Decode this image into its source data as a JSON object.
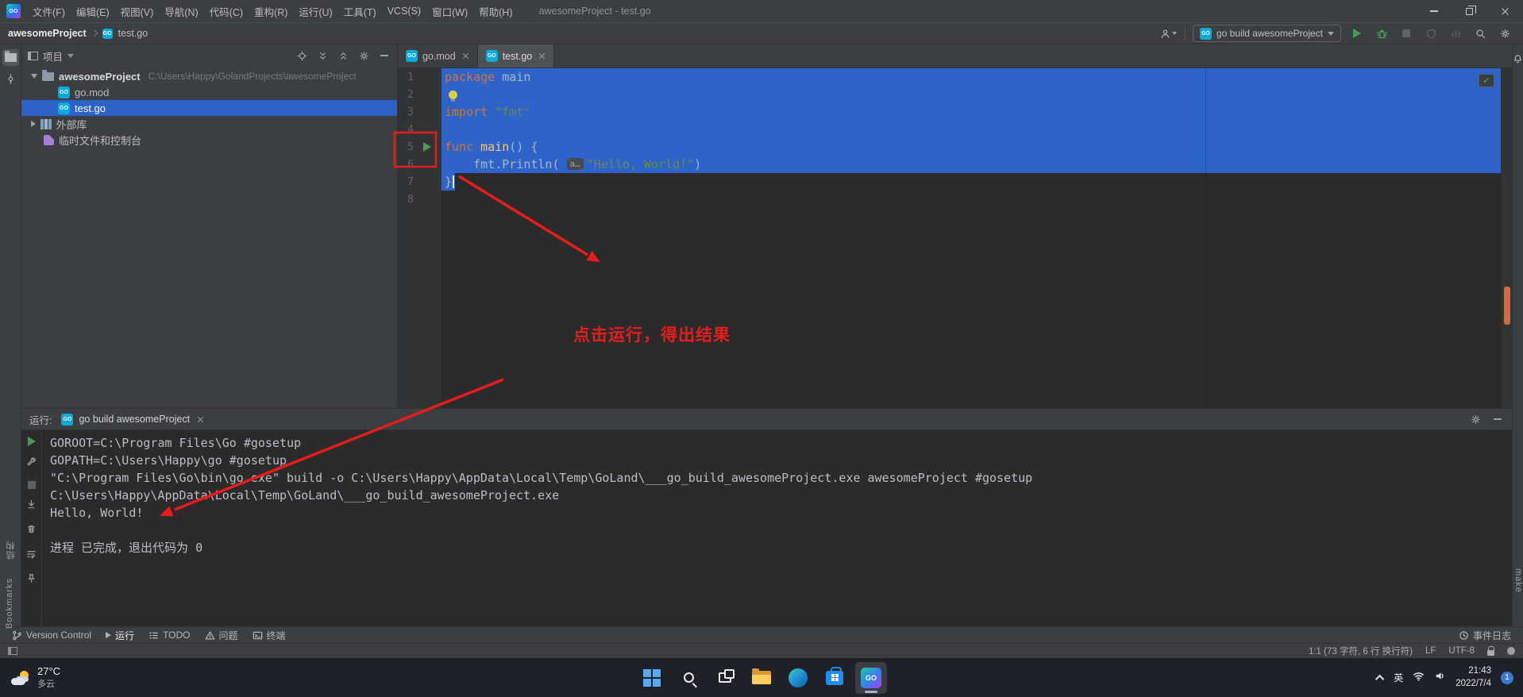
{
  "title_bar": {
    "app": "GO",
    "menus": [
      "文件(F)",
      "编辑(E)",
      "视图(V)",
      "导航(N)",
      "代码(C)",
      "重构(R)",
      "运行(U)",
      "工具(T)",
      "VCS(S)",
      "窗口(W)",
      "帮助(H)"
    ],
    "title": "awesomeProject - test.go"
  },
  "toolbar": {
    "breadcrumb_project": "awesomeProject",
    "breadcrumb_file": "test.go",
    "run_config": "go build awesomeProject"
  },
  "left_stripe": {
    "structure_label": "结构",
    "bookmarks_label": "Bookmarks"
  },
  "right_stripe": {
    "make_label": "make"
  },
  "project_panel": {
    "title": "项目",
    "root_name": "awesomeProject",
    "root_path": "C:\\Users\\Happy\\GolandProjects\\awesomeProject",
    "file1": "go.mod",
    "file2": "test.go",
    "external_libs": "外部库",
    "scratches": "临时文件和控制台"
  },
  "editor": {
    "tab1": "go.mod",
    "tab2": "test.go",
    "line_numbers": [
      "1",
      "2",
      "3",
      "4",
      "5",
      "6",
      "7",
      "8"
    ],
    "code": {
      "l1_kw": "package",
      "l1_id": " main",
      "l3_kw": "import",
      "l3_str": " \"fmt\"",
      "l5_kw": "func",
      "l5_fn": " main",
      "l5_tail": "() {",
      "l6_lead": "    fmt.",
      "l6_fn": "Println",
      "l6_paren": "( ",
      "l6_hint": "a…",
      "l6_str": "\"Hello, World!\"",
      "l6_close": ")",
      "l7": "}"
    }
  },
  "annotations": {
    "note": "点击运行，得出结果"
  },
  "run_panel": {
    "label": "运行:",
    "tab": "go build awesomeProject",
    "lines": [
      "GOROOT=C:\\Program Files\\Go #gosetup",
      "GOPATH=C:\\Users\\Happy\\go #gosetup",
      "\"C:\\Program Files\\Go\\bin\\go.exe\" build -o C:\\Users\\Happy\\AppData\\Local\\Temp\\GoLand\\___go_build_awesomeProject.exe awesomeProject #gosetup",
      "C:\\Users\\Happy\\AppData\\Local\\Temp\\GoLand\\___go_build_awesomeProject.exe",
      "Hello, World!",
      "",
      "进程 已完成，退出代码为 0"
    ]
  },
  "bottom_bar": {
    "version_control": "Version Control",
    "run": "运行",
    "todo": "TODO",
    "problems": "问题",
    "terminal": "终端",
    "event_log": "事件日志"
  },
  "status_bar": {
    "caret": "1:1 (73 字符, 6 行 换行符)",
    "line_sep": "LF",
    "encoding": "UTF-8"
  },
  "taskbar": {
    "temp": "27°C",
    "weather": "多云",
    "ime": "英",
    "time": "21:43",
    "date": "2022/7/4",
    "badge": "1"
  }
}
